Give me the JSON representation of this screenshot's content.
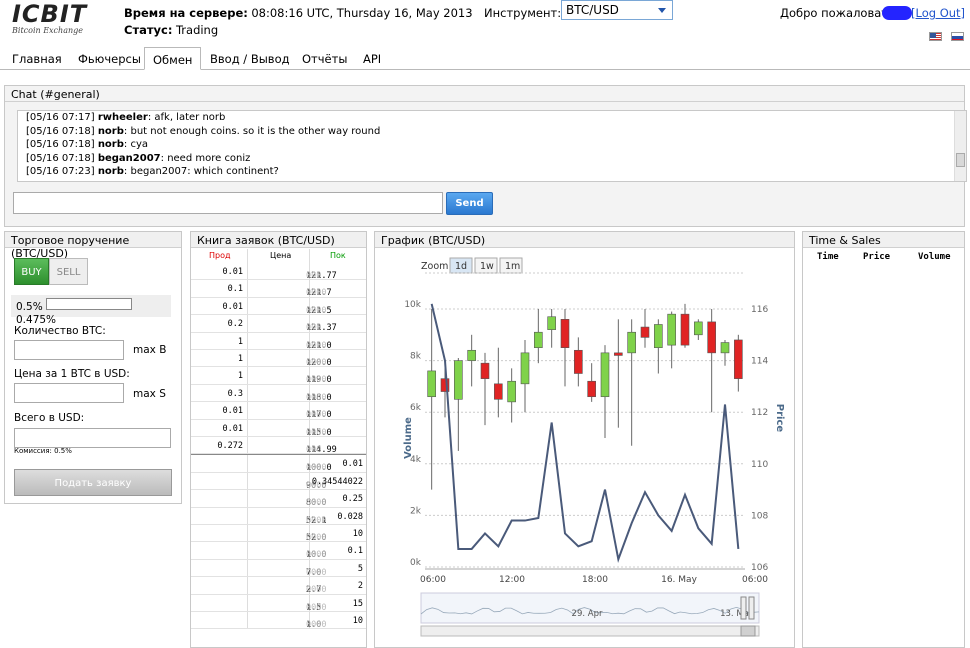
{
  "logo": {
    "title": "ICBIT",
    "subtitle": "Bitcoin Exchange"
  },
  "header": {
    "server_time_label": "Время на сервере:",
    "server_time_value": "08:08:16 UTC, Thursday 16, May 2013",
    "status_label": "Статус:",
    "status_value": "Trading",
    "instrument_label": "Инструмент:",
    "instrument_value": "BTC/USD",
    "welcome": "Добро пожаловать,",
    "logout_pre": "[",
    "logout": "Log Out",
    "logout_post": "]"
  },
  "tabs": [
    "Главная",
    "Фьючерсы",
    "Обмен",
    "Ввод / Вывод",
    "Отчёты",
    "API"
  ],
  "active_tab": "Обмен",
  "chat": {
    "title": "Chat (#general)",
    "messages": [
      {
        "time": "[05/16 07:17]",
        "user": "rwheeler",
        "text": "afk, later norb"
      },
      {
        "time": "[05/16 07:18]",
        "user": "norb",
        "text": "but not enough coins. so it is the other way round"
      },
      {
        "time": "[05/16 07:18]",
        "user": "norb",
        "text": "cya"
      },
      {
        "time": "[05/16 07:18]",
        "user": "began2007",
        "text": "need more coniz"
      },
      {
        "time": "[05/16 07:23]",
        "user": "norb",
        "text": "began2007: which continent?"
      }
    ],
    "input_value": "",
    "send_label": "Send"
  },
  "order": {
    "title": "Торговое поручение (BTC/USD)",
    "buy_label": "BUY",
    "sell_label": "SELL",
    "fee_top": "0.5%",
    "fee_bottom": "0.475%",
    "qty_label": "Количество BTC:",
    "qty_max": "max B",
    "price_label": "Цена за 1 BTC в USD:",
    "price_max": "max S",
    "total_label": "Всего в USD:",
    "commission": "Комиссия: 0.5%",
    "submit_label": "Подать заявку"
  },
  "order_book": {
    "title": "Книга заявок (BTC/USD)",
    "col_sell": "Прод",
    "col_price": "Цена",
    "col_buy": "Пок",
    "asks": [
      {
        "qty": "0.01",
        "price": "121.77",
        "pad": "000"
      },
      {
        "qty": "0.1",
        "price": "121.7",
        "pad": "0000"
      },
      {
        "qty": "0.01",
        "price": "121.5",
        "pad": "0000"
      },
      {
        "qty": "0.2",
        "price": "121.37",
        "pad": "000"
      },
      {
        "qty": "1",
        "price": "121.0",
        "pad": "0000"
      },
      {
        "qty": "1",
        "price": "120.0",
        "pad": "0000"
      },
      {
        "qty": "1",
        "price": "119.0",
        "pad": "0000"
      },
      {
        "qty": "0.3",
        "price": "118.0",
        "pad": "0000"
      },
      {
        "qty": "0.01",
        "price": "117.0",
        "pad": "0000"
      },
      {
        "qty": "0.01",
        "price": "115.0",
        "pad": "0000"
      },
      {
        "qty": "0.272",
        "price": "114.99",
        "pad": "000"
      }
    ],
    "bids": [
      {
        "price": "100.0",
        "pad": "0000",
        "qty": "0.01"
      },
      {
        "price": "90.0",
        "pad": "0000",
        "qty": "0.34544022"
      },
      {
        "price": "80.0",
        "pad": "0000",
        "qty": "0.25"
      },
      {
        "price": "52.1",
        "pad": "0000",
        "qty": "0.028"
      },
      {
        "price": "52.0",
        "pad": "0000",
        "qty": "10"
      },
      {
        "price": "10.0",
        "pad": "0000",
        "qty": "0.1"
      },
      {
        "price": "7.0",
        "pad": "0000",
        "qty": "5"
      },
      {
        "price": "2.7",
        "pad": "0000",
        "qty": "2"
      },
      {
        "price": "1.5",
        "pad": "0000",
        "qty": "15"
      },
      {
        "price": "1.0",
        "pad": "0000",
        "qty": "10"
      }
    ]
  },
  "chart_panel": {
    "title": "График (BTC/USD)",
    "zoom_label": "Zoom",
    "zoom_options": [
      "1d",
      "1w",
      "1m"
    ],
    "zoom_selected": "1d",
    "navigator_labels": [
      "29. Apr",
      "13. May"
    ]
  },
  "chart_data": {
    "type": "line",
    "title": "",
    "left_axis": {
      "label": "Volume",
      "ticks": [
        "0k",
        "2k",
        "4k",
        "6k",
        "8k",
        "10k"
      ],
      "range": [
        0,
        10000
      ]
    },
    "right_axis": {
      "label": "Price",
      "ticks": [
        "106",
        "108",
        "110",
        "112",
        "114",
        "116"
      ],
      "range": [
        106,
        116
      ]
    },
    "x_ticks": [
      "06:00",
      "12:00",
      "18:00",
      "16. May",
      "06:00"
    ],
    "grid": true,
    "candles": [
      {
        "o": 112.6,
        "h": 116,
        "l": 109,
        "c": 113.6
      },
      {
        "o": 113.3,
        "h": 114,
        "l": 111.8,
        "c": 112.8
      },
      {
        "o": 112.5,
        "h": 114.1,
        "l": 110.5,
        "c": 114
      },
      {
        "o": 114,
        "h": 115,
        "l": 113,
        "c": 114.4
      },
      {
        "o": 113.9,
        "h": 114.3,
        "l": 111.5,
        "c": 113.3
      },
      {
        "o": 113.1,
        "h": 114.5,
        "l": 111.8,
        "c": 112.5
      },
      {
        "o": 112.4,
        "h": 113.7,
        "l": 111.6,
        "c": 113.2
      },
      {
        "o": 113.1,
        "h": 114.8,
        "l": 112,
        "c": 114.3
      },
      {
        "o": 114.5,
        "h": 116,
        "l": 113.9,
        "c": 115.1
      },
      {
        "o": 115.2,
        "h": 116,
        "l": 114.5,
        "c": 115.7
      },
      {
        "o": 115.6,
        "h": 116,
        "l": 113,
        "c": 114.5
      },
      {
        "o": 114.4,
        "h": 114.9,
        "l": 113,
        "c": 113.5
      },
      {
        "o": 113.2,
        "h": 113.9,
        "l": 112.4,
        "c": 112.6
      },
      {
        "o": 112.6,
        "h": 114.6,
        "l": 111,
        "c": 114.3
      },
      {
        "o": 114.3,
        "h": 115.6,
        "l": 111.4,
        "c": 114.2
      },
      {
        "o": 114.3,
        "h": 115.6,
        "l": 110.7,
        "c": 115.1
      },
      {
        "o": 115.3,
        "h": 116,
        "l": 114.5,
        "c": 114.9
      },
      {
        "o": 114.5,
        "h": 115.6,
        "l": 113.5,
        "c": 115.4
      },
      {
        "o": 114.6,
        "h": 115.9,
        "l": 113.7,
        "c": 115.8
      },
      {
        "o": 115.8,
        "h": 116.2,
        "l": 114.5,
        "c": 114.6
      },
      {
        "o": 115,
        "h": 115.6,
        "l": 114.8,
        "c": 115.5
      },
      {
        "o": 115.5,
        "h": 116,
        "l": 112,
        "c": 114.3
      },
      {
        "o": 114.3,
        "h": 114.8,
        "l": 113.8,
        "c": 114.7
      },
      {
        "o": 114.8,
        "h": 115,
        "l": 112.8,
        "c": 113.3
      }
    ],
    "volume": [
      10200,
      8000,
      700,
      700,
      1300,
      800,
      1800,
      1800,
      1900,
      5600,
      1300,
      800,
      1000,
      3000,
      300,
      1700,
      2900,
      2000,
      1400,
      2800,
      1500,
      900,
      6300,
      700
    ]
  },
  "time_sales": {
    "title": "Time & Sales",
    "col_time": "Time",
    "col_price": "Price",
    "col_volume": "Volume"
  }
}
